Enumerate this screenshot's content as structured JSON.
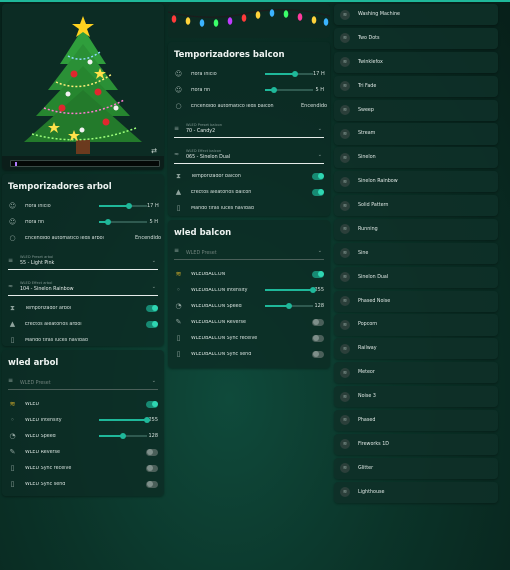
{
  "colors": {
    "accent": "#1fb89a",
    "card": "#0c2c24",
    "toggle_on": "#2fd6b2"
  },
  "arbol_timers": {
    "title": "Temporizadores arbol",
    "hora_inicio_label": "Hora Inicio",
    "hora_inicio_value": "17 H",
    "hora_inicio_level": 0.62,
    "hora_fin_label": "Hora fin",
    "hora_fin_value": "5 H",
    "hora_fin_level": 0.18,
    "auto_label": "Encendido automatico leds arbol",
    "auto_value": "Encendido",
    "preset_caption": "WLED Preset arbol",
    "preset_value": "55 - Light Pink",
    "effect_caption": "WLED Effect arbol",
    "effect_value": "104 - Sinelon Rainbow",
    "temp_label": "Temporizador arbol",
    "efectos_label": "Efectos aleatorios arbol",
    "mando_label": "Mando tiras luces navidad"
  },
  "wled_arbol": {
    "title": "wled arbol",
    "preset_caption": "WLED Preset",
    "main_label": "WLED",
    "intensity_label": "WLED Intensity",
    "intensity_value": "255",
    "intensity_level": 1.0,
    "speed_label": "WLED Speed",
    "speed_value": "128",
    "speed_level": 0.5,
    "reverse_label": "WLED Reverse",
    "sync_recv_label": "WLED Sync receive",
    "sync_send_label": "WLED Sync send"
  },
  "balcon_timers": {
    "title": "Temporizadores balcon",
    "hora_inicio_label": "Hora Inicio",
    "hora_inicio_value": "17 H",
    "hora_inicio_level": 0.62,
    "hora_fin_label": "Hora fin",
    "hora_fin_value": "5 H",
    "hora_fin_level": 0.18,
    "auto_label": "Encendido automatico leds balcon",
    "auto_value": "Encendido",
    "preset_caption": "WLED Preset balcon",
    "preset_value": "70 - Candy2",
    "effect_caption": "WLED Effect balcon",
    "effect_value": "065 - Sinelon Dual",
    "temp_label": "Temporizador balcon",
    "efectos_label": "Efectos aleatorios balcon",
    "mando_label": "Mando tiras luces navidad"
  },
  "wled_balcon": {
    "title": "wled balcon",
    "preset_caption": "WLED Preset",
    "main_label": "WLEDBALCON",
    "intensity_label": "WLEDBALCON Intensity",
    "intensity_value": "255",
    "intensity_level": 1.0,
    "speed_label": "WLEDBALCON Speed",
    "speed_value": "128",
    "speed_level": 0.5,
    "reverse_label": "WLEDBALCON Reverse",
    "sync_recv_label": "WLEDBALCON Sync receive",
    "sync_send_label": "WLEDBALCON Sync send"
  },
  "effects": [
    "Washing Machine",
    "Two Dots",
    "Twinklefox",
    "Tri Fade",
    "Sweep",
    "Stream",
    "Sinelon",
    "Sinelon Rainbow",
    "Solid Pattern",
    "Running",
    "Sine",
    "Sinelon Dual",
    "Phased Noise",
    "Popcorn",
    "Railway",
    "Meteor",
    "Noise 3",
    "Phased",
    "Fireworks 1D",
    "Glitter",
    "Lighthouse"
  ]
}
